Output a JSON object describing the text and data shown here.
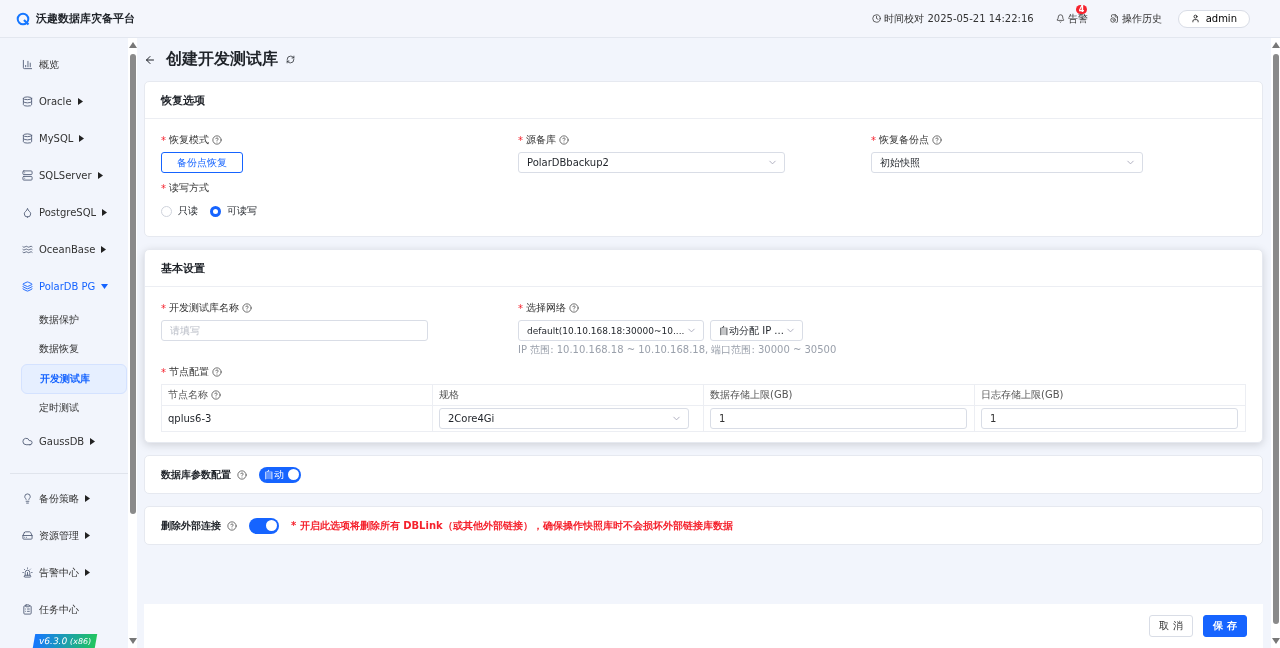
{
  "header": {
    "product": "沃趣数据库灾备平台",
    "clock": "时间校对 2025-05-21 14:22:16",
    "alerts": {
      "label": "告警",
      "count": "4"
    },
    "history": "操作历史",
    "user": "admin"
  },
  "sidebar": {
    "groups": [
      {
        "items": [
          {
            "label": "概览",
            "expandable": false,
            "selected": false
          },
          {
            "label": "Oracle",
            "expandable": true,
            "expanded": false,
            "selected": false
          },
          {
            "label": "MySQL",
            "expandable": true,
            "expanded": false,
            "selected": false
          },
          {
            "label": "SQLServer",
            "expandable": true,
            "expanded": false,
            "selected": false
          },
          {
            "label": "PostgreSQL",
            "expandable": true,
            "expanded": false,
            "selected": false
          },
          {
            "label": "OceanBase",
            "expandable": true,
            "expanded": false,
            "selected": false
          },
          {
            "label": "PolarDB PG",
            "expandable": true,
            "expanded": true,
            "selected": true,
            "children": [
              {
                "label": "数据保护",
                "selected": false
              },
              {
                "label": "数据恢复",
                "selected": false
              },
              {
                "label": "开发测试库",
                "selected": true
              },
              {
                "label": "定时测试",
                "selected": false
              }
            ]
          },
          {
            "label": "GaussDB",
            "expandable": true,
            "expanded": false,
            "selected": false
          }
        ]
      },
      {
        "items": [
          {
            "label": "备份策略",
            "expandable": true,
            "expanded": false,
            "selected": false
          },
          {
            "label": "资源管理",
            "expandable": true,
            "expanded": false,
            "selected": false
          },
          {
            "label": "告警中心",
            "expandable": true,
            "expanded": false,
            "selected": false
          },
          {
            "label": "任务中心",
            "expandable": false,
            "selected": false
          }
        ]
      }
    ],
    "version": "v6.3.0",
    "arch": "(x86)"
  },
  "page": {
    "title": "创建开发测试库",
    "restore": {
      "title": "恢复选项",
      "mode": {
        "required_mark": "*",
        "label": "恢复模式",
        "value": "备份点恢复"
      },
      "source": {
        "required_mark": "*",
        "label": "源备库",
        "value": "PolarDBbackup2"
      },
      "point": {
        "required_mark": "*",
        "label": "恢复备份点",
        "value": "初始快照"
      },
      "access": {
        "required_mark": "*",
        "label": "读写方式",
        "options": [
          {
            "label": "只读",
            "selected": false
          },
          {
            "label": "可读写",
            "selected": true
          }
        ]
      }
    },
    "basic": {
      "title": "基本设置",
      "name": {
        "required_mark": "*",
        "label": "开发测试库名称",
        "placeholder": "请填写"
      },
      "network": {
        "required_mark": "*",
        "label": "选择网络",
        "value": "default(10.10.168.18:30000~10....",
        "ip_mode": "自动分配 IP ...",
        "hint": "IP 范围: 10.10.168.18 ~ 10.10.168.18, 端口范围: 30000 ~ 30500"
      },
      "nodes": {
        "required_mark": "*",
        "label": "节点配置",
        "columns": [
          "节点名称",
          "规格",
          "数据存储上限(GB)",
          "日志存储上限(GB)"
        ],
        "rows": [
          {
            "name": "qplus6-3",
            "spec": "2Core4Gi",
            "data_limit": "1",
            "log_limit": "1"
          }
        ]
      }
    },
    "params": {
      "label": "数据库参数配置",
      "on": true,
      "toggle_text": "自动"
    },
    "dblink": {
      "label": "删除外部连接",
      "on": true,
      "warning": "* 开启此选项将删除所有 DBLink（或其他外部链接），确保操作快照库时不会损坏外部链接库数据"
    },
    "buttons": {
      "cancel": "取 消",
      "save": "保 存"
    }
  }
}
